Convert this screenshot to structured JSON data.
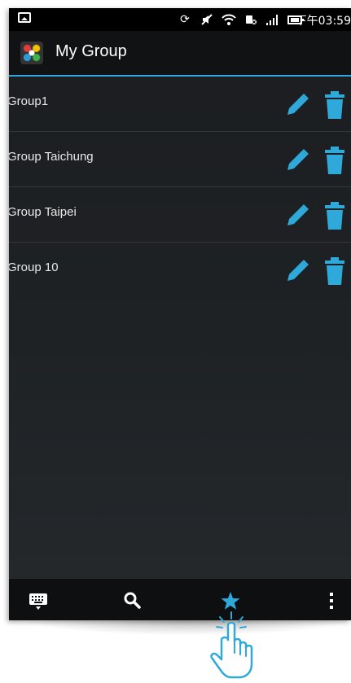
{
  "status_bar": {
    "time": "下午03:59",
    "icons": [
      "image-notification-icon",
      "sync-icon",
      "mute-icon",
      "wifi-icon",
      "usb-icon",
      "signal-icon",
      "battery-icon"
    ]
  },
  "action_bar": {
    "title": "My Group",
    "app_icon": "app-logo-icon",
    "accent_color": "#2fa9d9"
  },
  "groups": [
    {
      "name": "Group1"
    },
    {
      "name": "Group Taichung"
    },
    {
      "name": "Group Taipei"
    },
    {
      "name": "Group 10"
    }
  ],
  "row_actions": {
    "edit_icon": "pencil-icon",
    "delete_icon": "trash-icon"
  },
  "bottom_bar": {
    "items": [
      {
        "icon": "keyboard-icon"
      },
      {
        "icon": "search-icon"
      },
      {
        "icon": "star-icon",
        "active": true
      },
      {
        "icon": "overflow-menu-icon"
      }
    ]
  },
  "colors": {
    "accent": "#2fa9d9",
    "background": "#1f2225",
    "text": "#e8e8e8"
  }
}
